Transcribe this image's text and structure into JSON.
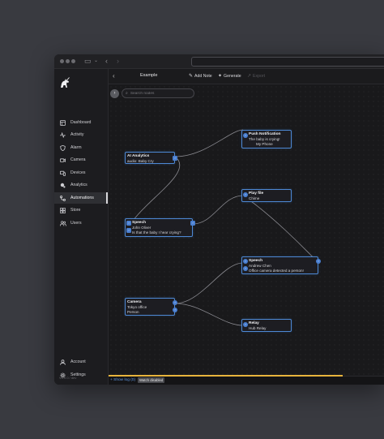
{
  "sidebar": {
    "items": [
      {
        "label": "Dashboard",
        "icon": "dashboard-icon"
      },
      {
        "label": "Activity",
        "icon": "activity-icon"
      },
      {
        "label": "Alarm",
        "icon": "shield-icon"
      },
      {
        "label": "Camera",
        "icon": "camera-icon"
      },
      {
        "label": "Devices",
        "icon": "devices-icon"
      },
      {
        "label": "Analytics",
        "icon": "analytics-icon"
      },
      {
        "label": "Automations",
        "icon": "automations-icon",
        "active": true
      },
      {
        "label": "Store",
        "icon": "store-icon"
      },
      {
        "label": "Users",
        "icon": "users-icon"
      }
    ],
    "bottom_items": [
      {
        "label": "Account",
        "icon": "account-icon"
      },
      {
        "label": "Settings",
        "icon": "gear-icon"
      }
    ],
    "version": "V1.0.0 / dev"
  },
  "toolbar": {
    "back_icon": "‹",
    "title": "Example",
    "add_note": "Add Note",
    "generate": "Generate",
    "export": "Export"
  },
  "search": {
    "placeholder": "Search nodes"
  },
  "nodes": {
    "ai_analytics": {
      "title": "AI Analytics",
      "line1": "audio: Baby Cry"
    },
    "push": {
      "title": "Push Notification",
      "line1": "The baby is crying!",
      "line2": "My Phone"
    },
    "speech1": {
      "title": "Speech",
      "line1": "John Oliver",
      "line2": "Is that the baby I hear crying?"
    },
    "play_file": {
      "title": "Play file",
      "line1": "Chime"
    },
    "speech2": {
      "title": "Speech",
      "line1": "Andrew Chen",
      "line2": "Office camera detected a person!"
    },
    "camera": {
      "title": "Camera",
      "line1": "Tokyo office",
      "line2": "Person"
    },
    "relay": {
      "title": "Relay",
      "line1": "Hub Relay"
    }
  },
  "footer": {
    "show_log": "Show log (0)",
    "watch_status": "Watch disabled",
    "progress": 0.85
  },
  "colors": {
    "accent": "#4d88d4",
    "edge": "#8a8a90",
    "progress": "#e7b43c"
  }
}
